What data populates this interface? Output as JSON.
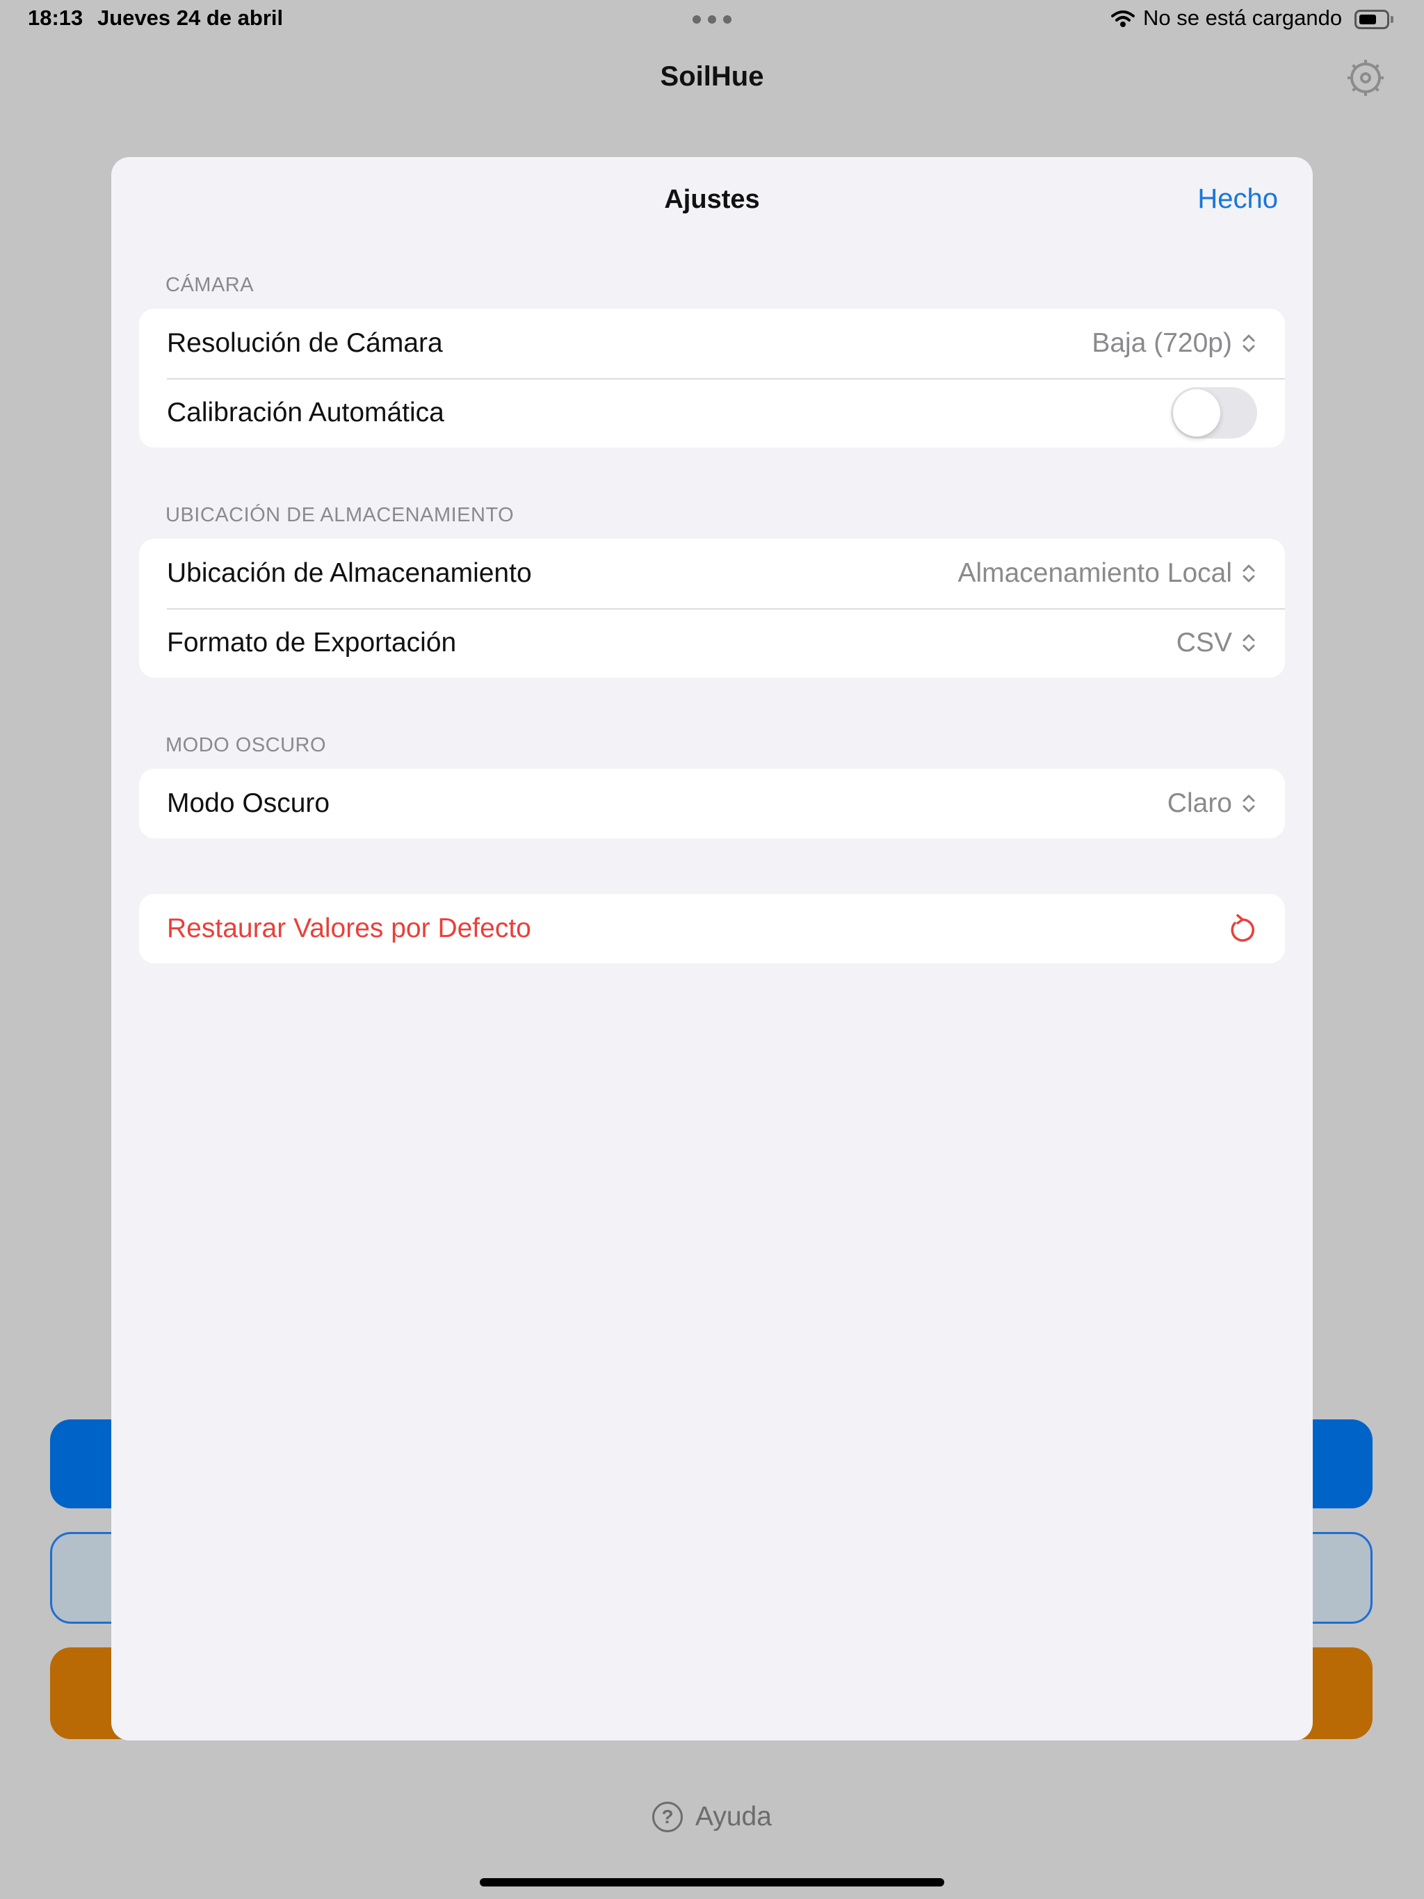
{
  "status_bar": {
    "time": "18:13",
    "date": "Jueves 24 de abril",
    "battery_status": "No se está cargando"
  },
  "app": {
    "title": "SoilHue",
    "help_label": "Ayuda"
  },
  "sheet": {
    "title": "Ajustes",
    "done_label": "Hecho",
    "sections": {
      "camera": {
        "header": "CÁMARA",
        "resolution_label": "Resolución de Cámara",
        "resolution_value": "Baja (720p)",
        "auto_calibration_label": "Calibración Automática",
        "auto_calibration_enabled": false
      },
      "storage": {
        "header": "UBICACIÓN DE ALMACENAMIENTO",
        "location_label": "Ubicación de Almacenamiento",
        "location_value": "Almacenamiento Local",
        "export_label": "Formato de Exportación",
        "export_value": "CSV"
      },
      "dark_mode": {
        "header": "MODO OSCURO",
        "mode_label": "Modo Oscuro",
        "mode_value": "Claro"
      },
      "reset": {
        "label": "Restaurar Valores por Defecto"
      }
    }
  },
  "colors": {
    "accent": "#1a76d8",
    "destructive": "#e8403a",
    "primary_button": "#0063c8",
    "orange_button": "#b96a04"
  }
}
